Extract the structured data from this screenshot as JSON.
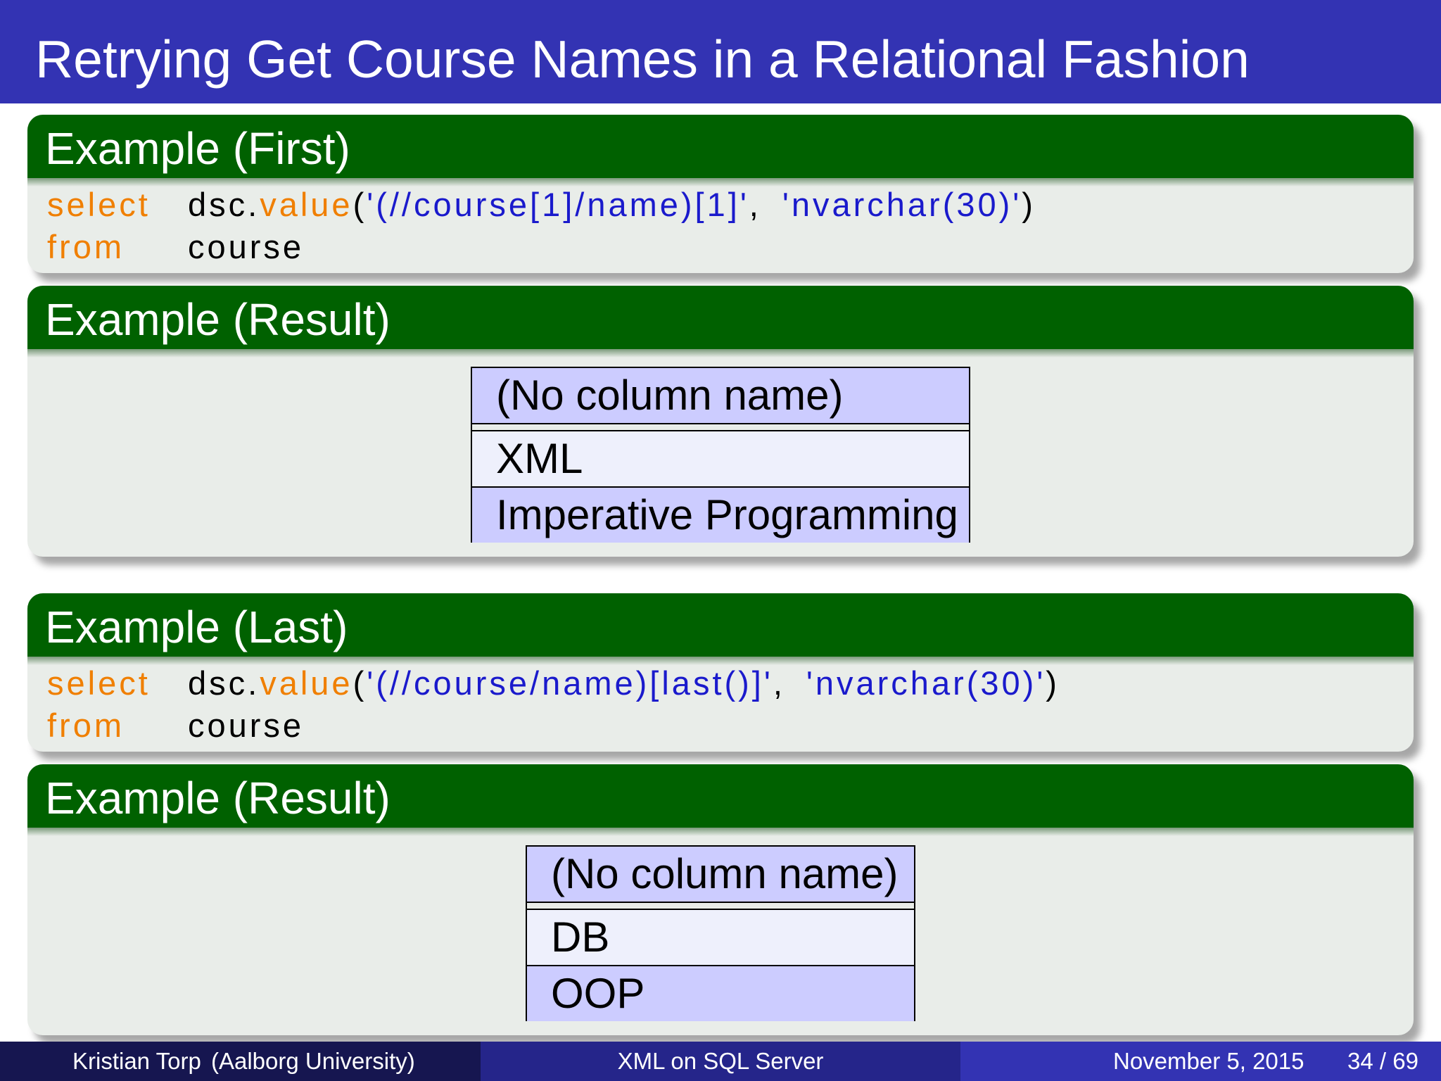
{
  "slide": {
    "title": "Retrying Get Course Names in a Relational Fashion"
  },
  "blocks": {
    "first": {
      "title": "Example (First)",
      "line1": {
        "kw": "select",
        "ident": "dsc.",
        "func": "value",
        "open": "(",
        "arg1": "'(//course[1]/name)[1]'",
        "comma": ",",
        "arg2": "'nvarchar(30)'",
        "close": ")"
      },
      "line2": {
        "kw": "from",
        "ident": "course"
      }
    },
    "result1": {
      "title": "Example (Result)",
      "header": "(No column name)",
      "rows": [
        "XML",
        "Imperative Programming"
      ]
    },
    "last": {
      "title": "Example (Last)",
      "line1": {
        "kw": "select",
        "ident": "dsc.",
        "func": "value",
        "open": "(",
        "arg1": "'(//course/name)[last()]'",
        "comma": ",",
        "arg2": "'nvarchar(30)'",
        "close": ")"
      },
      "line2": {
        "kw": "from",
        "ident": "course"
      }
    },
    "result2": {
      "title": "Example (Result)",
      "header": "(No column name)",
      "rows": [
        "DB",
        "OOP"
      ]
    }
  },
  "footer": {
    "author": "Kristian Torp",
    "institution": "(Aalborg University)",
    "topic": "XML on SQL Server",
    "date": "November 5, 2015",
    "page": "34 / 69"
  },
  "colors": {
    "title_bar": "#3333b3",
    "block_header": "#006100",
    "block_body": "#e9ede9",
    "keyword": "#f07f00",
    "string": "#1a1acc",
    "table_header": "#ccccff"
  }
}
